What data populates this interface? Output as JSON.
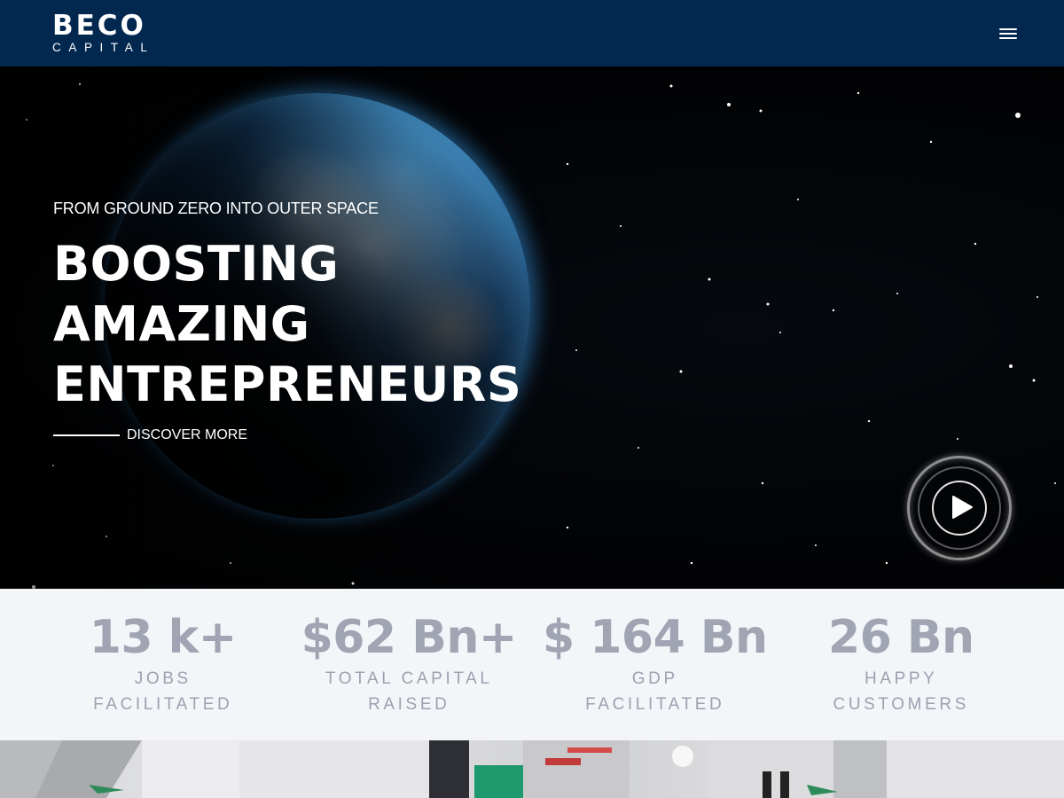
{
  "header": {
    "logo_main": "BECO",
    "logo_sub": "CAPITAL",
    "menu_icon": "hamburger-menu-icon"
  },
  "hero": {
    "kicker": "FROM GROUND ZERO INTO OUTER SPACE",
    "title_lines": [
      "BOOSTING",
      "AMAZING",
      "ENTREPRENEURS"
    ],
    "cta_label": "DISCOVER MORE",
    "play_icon": "play-icon"
  },
  "stats": [
    {
      "value": "13 k+",
      "label": "JOBS FACILITATED"
    },
    {
      "value": "$62 Bn+",
      "label": "TOTAL CAPITAL RAISED"
    },
    {
      "value": "$ 164 Bn",
      "label": "GDP FACILITATED"
    },
    {
      "value": "26 Bn",
      "label": "HAPPY CUSTOMERS"
    }
  ],
  "colors": {
    "header_bg": "#03284f",
    "stats_bg": "#f3f5f9",
    "stat_text": "#a1a4b2"
  }
}
